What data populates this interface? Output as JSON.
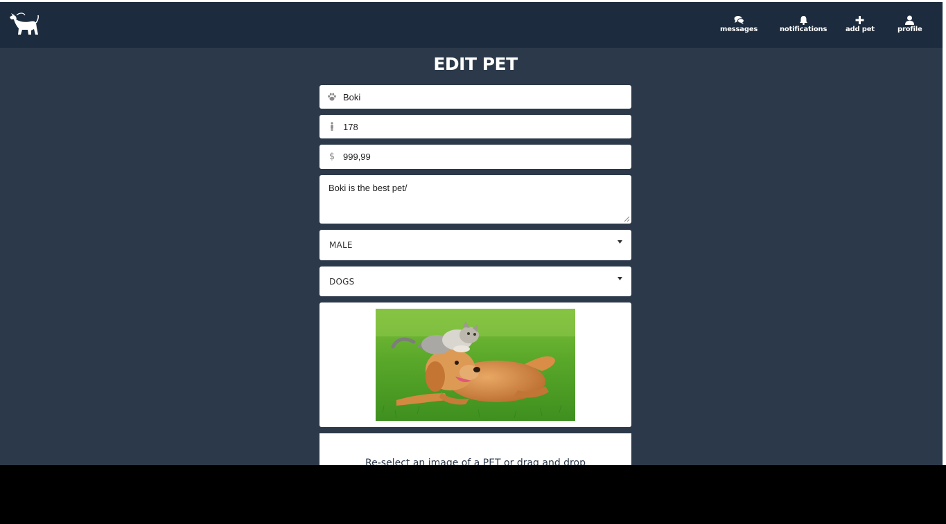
{
  "navbar": {
    "logo_icon": "dog-on-leash-icon",
    "items": [
      {
        "label": "messages",
        "icon": "chat-bubbles-icon"
      },
      {
        "label": "notifications",
        "icon": "bell-icon"
      },
      {
        "label": "add pet",
        "icon": "plus-icon"
      },
      {
        "label": "profile",
        "icon": "user-icon"
      }
    ]
  },
  "page": {
    "title": "EDIT PET"
  },
  "form": {
    "name": {
      "value": "Boki",
      "icon": "paw-icon"
    },
    "height": {
      "value": "178",
      "icon": "person-icon"
    },
    "price": {
      "value": "999,99",
      "icon": "dollar-icon"
    },
    "description": {
      "value": "Boki is the best pet/"
    },
    "gender": {
      "selected": "MALE"
    },
    "category": {
      "selected": "DOGS"
    },
    "image": {
      "alt": "Golden retriever and kitten on grass"
    },
    "dropzone_text": "Re-select an image of a PET or drag and drop"
  },
  "colors": {
    "navbar": "#1c2b3e",
    "background": "#2c394a",
    "field": "#ffffff"
  }
}
